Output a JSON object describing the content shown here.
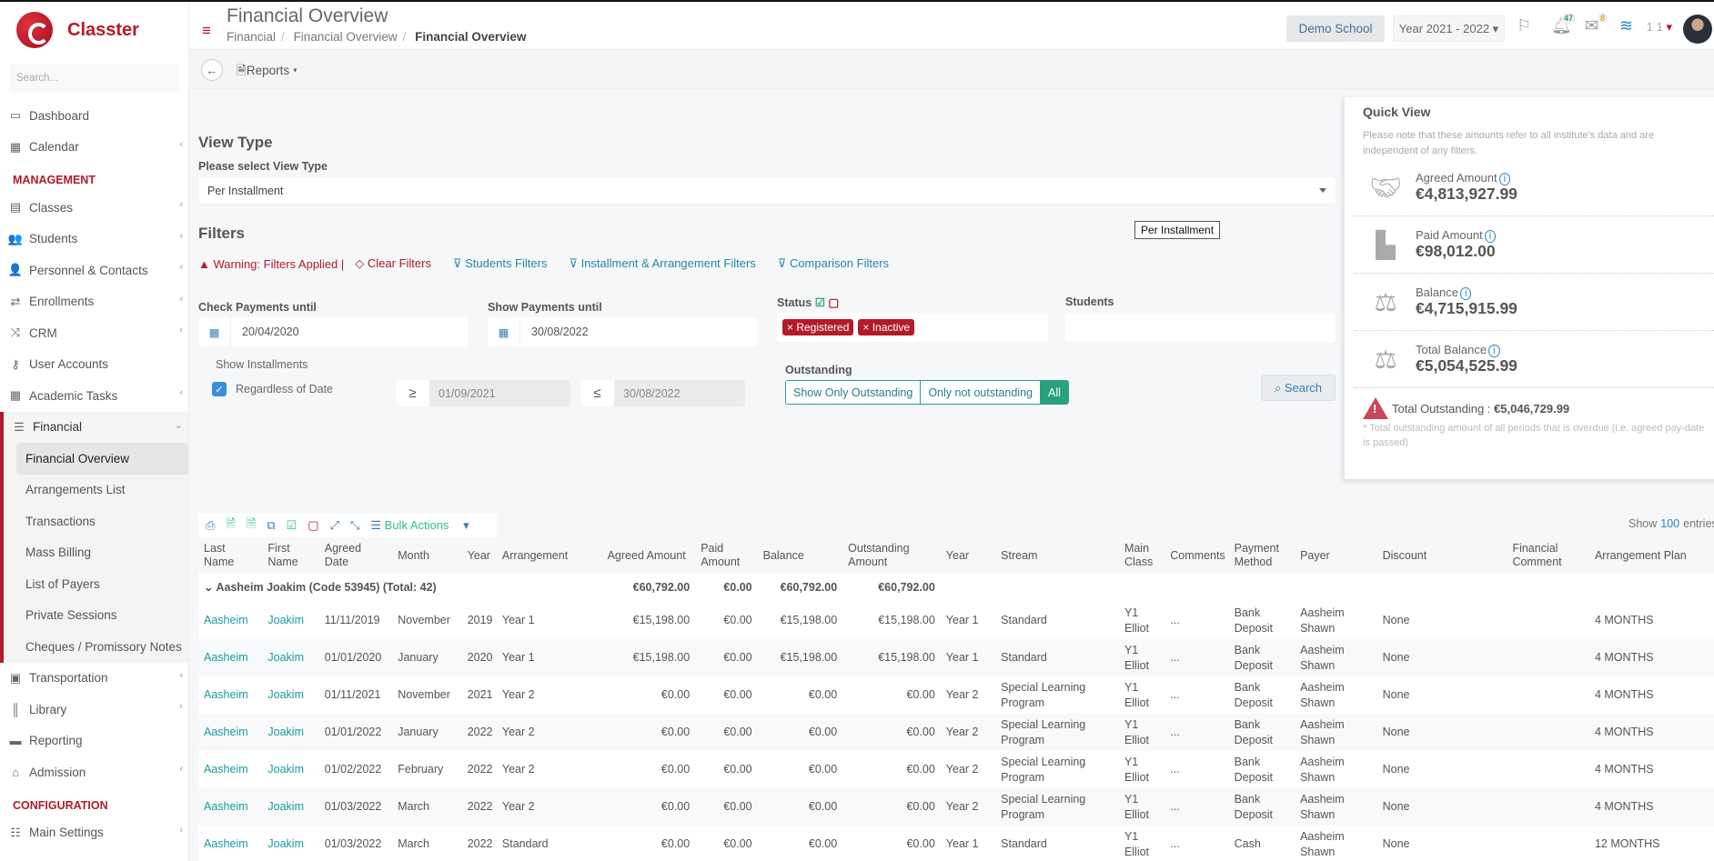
{
  "sidebar": {
    "brand": "Classter",
    "search_placeholder": "Search...",
    "items_top": [
      {
        "label": "Dashboard",
        "icon": "laptop-icon"
      },
      {
        "label": "Calendar",
        "icon": "calendar-icon",
        "chevron": true
      }
    ],
    "section_management": "MANAGEMENT",
    "management": [
      {
        "label": "Classes",
        "icon": "classes-icon"
      },
      {
        "label": "Students",
        "icon": "students-icon"
      },
      {
        "label": "Personnel & Contacts",
        "icon": "personnel-icon"
      },
      {
        "label": "Enrollments",
        "icon": "exchange-icon"
      },
      {
        "label": "CRM",
        "icon": "shuffle-icon"
      },
      {
        "label": "User Accounts",
        "icon": "key-icon"
      },
      {
        "label": "Academic Tasks",
        "icon": "grid-icon"
      }
    ],
    "financial": "Financial",
    "financial_sub": [
      "Financial Overview",
      "Arrangements List",
      "Transactions",
      "Mass Billing",
      "List of Payers",
      "Private Sessions",
      "Cheques / Promissory Notes"
    ],
    "after": [
      {
        "label": "Transportation",
        "icon": "bus-icon"
      },
      {
        "label": "Library",
        "icon": "books-icon"
      },
      {
        "label": "Reporting",
        "icon": "print-icon"
      },
      {
        "label": "Admission",
        "icon": "bank-icon"
      }
    ],
    "section_config": "CONFIGURATION",
    "main_settings": "Main Settings"
  },
  "header": {
    "title": "Financial Overview",
    "breadcrumb": [
      "Financial",
      "Financial Overview",
      "Financial Overview"
    ],
    "school": "Demo School",
    "year": "Year 2021 - 2022",
    "notifications": "47",
    "messages": "8",
    "user": "1 1"
  },
  "subbar": {
    "reports": "Reports"
  },
  "view_type": {
    "heading": "View Type",
    "label": "Please select View Type",
    "value": "Per Installment",
    "tooltip": "Per Installment"
  },
  "filters": {
    "heading": "Filters",
    "warning": "Warning: Filters Applied",
    "clear": "Clear Filters",
    "students": "Students Filters",
    "installment": "Installment & Arrangement Filters",
    "comparison": "Comparison Filters",
    "check_label": "Check Payments until",
    "check_value": "20/04/2020",
    "show_label": "Show Payments until",
    "show_value": "30/08/2022",
    "status_label": "Status",
    "status_tags": [
      "Registered",
      "Inactive"
    ],
    "students_label": "Students",
    "show_installments": "Show Installments",
    "regardless": "Regardless of Date",
    "from_op": "≥",
    "from_value": "01/09/2021",
    "to_op": "≤",
    "to_value": "30/08/2022",
    "outstanding_label": "Outstanding",
    "outstanding_opts": [
      "Show Only Outstanding",
      "Only not outstanding",
      "All"
    ],
    "search": "Search"
  },
  "quick_view": {
    "title": "Quick View",
    "note": "Please note that these amounts refer to all institute's data and are independent of any filters.",
    "items": [
      {
        "label": "Agreed Amount",
        "value": "€4,813,927.99"
      },
      {
        "label": "Paid Amount",
        "value": "€98,012.00"
      },
      {
        "label": "Balance",
        "value": "€4,715,915.99"
      },
      {
        "label": "Total Balance",
        "value": "€5,054,525.99"
      }
    ],
    "outstanding_label": "Total Outstanding :",
    "outstanding_value": "€5,046,729.99",
    "outstanding_note": "* Total outstanding amount of all periods that is overdue (i.e. agreed pay-date is passed)"
  },
  "table": {
    "bulk": "Bulk Actions",
    "show": "Show",
    "show_n": "100",
    "entries": "entries",
    "headers": [
      "Last Name",
      "First Name",
      "Agreed Date",
      "Month",
      "Year",
      "Arrangement",
      "Agreed Amount",
      "Paid Amount",
      "Balance",
      "Outstanding Amount",
      "Year",
      "Stream",
      "Main Class",
      "Comments",
      "Payment Method",
      "Payer",
      "Discount",
      "Financial Comment",
      "Arrangement Plan"
    ],
    "group": {
      "label": "Aasheim Joakim (Code 53945) (Total: 42)",
      "agreed": "€60,792.00",
      "paid": "€0.00",
      "balance": "€60,792.00",
      "outstanding": "€60,792.00"
    },
    "rows": [
      [
        "Aasheim",
        "Joakim",
        "11/11/2019",
        "November",
        "2019",
        "Year 1",
        "€15,198.00",
        "€0.00",
        "€15,198.00",
        "€15,198.00",
        "Year 1",
        "Standard",
        "Y1 Elliot",
        "...",
        "Bank Deposit",
        "Aasheim Shawn",
        "None",
        "",
        "4 MONTHS"
      ],
      [
        "Aasheim",
        "Joakim",
        "01/01/2020",
        "January",
        "2020",
        "Year 1",
        "€15,198.00",
        "€0.00",
        "€15,198.00",
        "€15,198.00",
        "Year 1",
        "Standard",
        "Y1 Elliot",
        "...",
        "Bank Deposit",
        "Aasheim Shawn",
        "None",
        "",
        "4 MONTHS"
      ],
      [
        "Aasheim",
        "Joakim",
        "01/11/2021",
        "November",
        "2021",
        "Year 2",
        "€0.00",
        "€0.00",
        "€0.00",
        "€0.00",
        "Year 2",
        "Special Learning Program",
        "Y1 Elliot",
        "...",
        "Bank Deposit",
        "Aasheim Shawn",
        "None",
        "",
        "4 MONTHS"
      ],
      [
        "Aasheim",
        "Joakim",
        "01/01/2022",
        "January",
        "2022",
        "Year 2",
        "€0.00",
        "€0.00",
        "€0.00",
        "€0.00",
        "Year 2",
        "Special Learning Program",
        "Y1 Elliot",
        "...",
        "Bank Deposit",
        "Aasheim Shawn",
        "None",
        "",
        "4 MONTHS"
      ],
      [
        "Aasheim",
        "Joakim",
        "01/02/2022",
        "February",
        "2022",
        "Year 2",
        "€0.00",
        "€0.00",
        "€0.00",
        "€0.00",
        "Year 2",
        "Special Learning Program",
        "Y1 Elliot",
        "...",
        "Bank Deposit",
        "Aasheim Shawn",
        "None",
        "",
        "4 MONTHS"
      ],
      [
        "Aasheim",
        "Joakim",
        "01/03/2022",
        "March",
        "2022",
        "Year 2",
        "€0.00",
        "€0.00",
        "€0.00",
        "€0.00",
        "Year 2",
        "Special Learning Program",
        "Y1 Elliot",
        "...",
        "Bank Deposit",
        "Aasheim Shawn",
        "None",
        "",
        "4 MONTHS"
      ],
      [
        "Aasheim",
        "Joakim",
        "01/03/2022",
        "March",
        "2022",
        "Standard",
        "€0.00",
        "€0.00",
        "€0.00",
        "€0.00",
        "Year 1",
        "Standard",
        "Y1 Elliot",
        "...",
        "Cash",
        "Aasheim Shawn",
        "None",
        "",
        "12 MONTHS"
      ]
    ]
  }
}
